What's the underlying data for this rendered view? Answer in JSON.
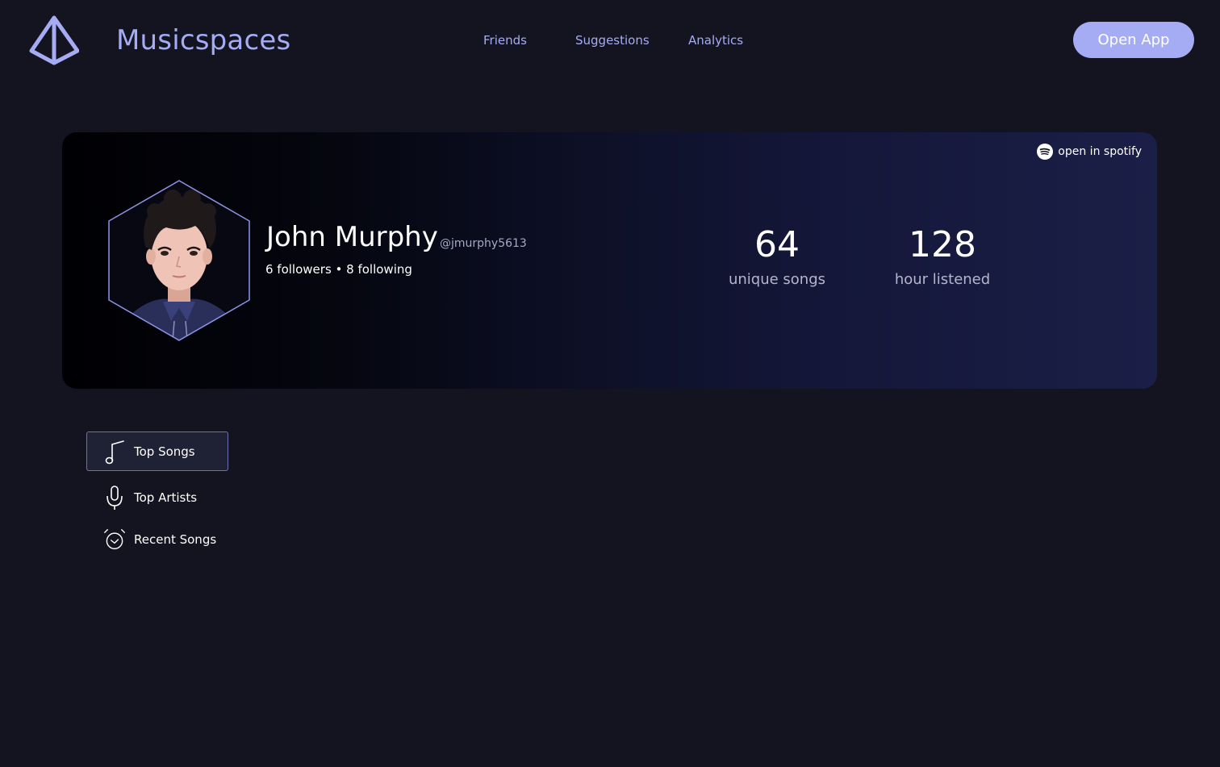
{
  "header": {
    "brand": "Musicspaces",
    "nav": [
      "Friends",
      "Suggestions",
      "Analytics"
    ],
    "open_app": "Open App"
  },
  "profile": {
    "spotify_link": "open in spotify",
    "name": "John Murphy",
    "handle": "@jmurphy5613",
    "follow_text": "6 followers • 8 following",
    "stats": [
      {
        "value": "64",
        "label": "unique songs"
      },
      {
        "value": "128",
        "label": "hour listened"
      }
    ]
  },
  "menu": {
    "items": [
      {
        "label": "Top Songs",
        "icon": "music-note-icon",
        "active": true
      },
      {
        "label": "Top Artists",
        "icon": "microphone-icon",
        "active": false
      },
      {
        "label": "Recent Songs",
        "icon": "alarm-clock-icon",
        "active": false
      }
    ]
  },
  "colors": {
    "accent": "#a5acf4",
    "background": "#141420"
  }
}
